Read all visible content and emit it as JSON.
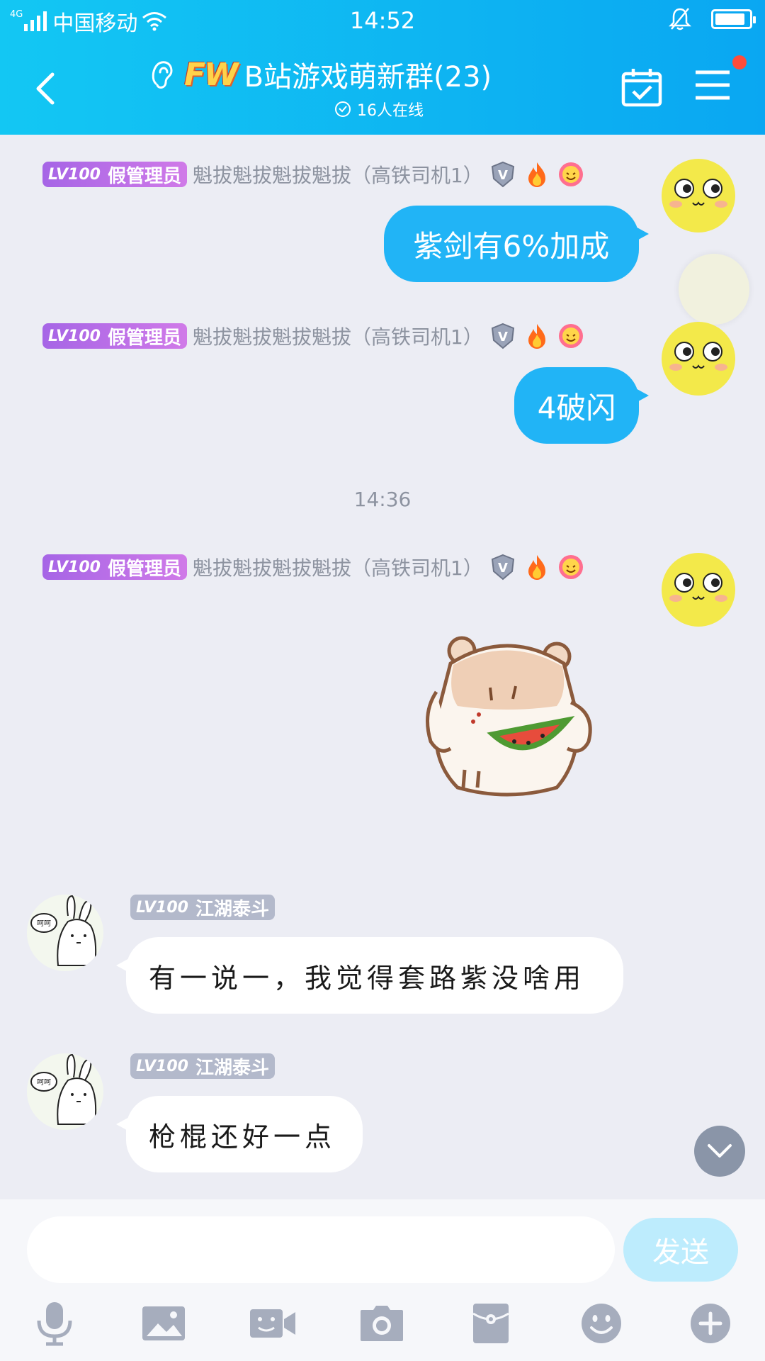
{
  "status_bar": {
    "network_tag": "4G",
    "carrier": "中国移动",
    "time": "14:52",
    "battery_level": 0.9
  },
  "header": {
    "logo_text": "FW",
    "group_name": "B站游戏萌新群(23)",
    "online_text": "16人在线",
    "notification_dot_color": "#ff4c3b"
  },
  "messages": [
    {
      "side": "right",
      "badge_level": "LV100",
      "badge_title": "假管理员",
      "sender": "魁拔魁拔魁拔魁拔（高铁司机1）",
      "text": "紫剑有6%加成"
    },
    {
      "side": "right",
      "badge_level": "LV100",
      "badge_title": "假管理员",
      "sender": "魁拔魁拔魁拔魁拔（高铁司机1）",
      "text": "4破闪"
    },
    {
      "side": "right",
      "badge_level": "LV100",
      "badge_title": "假管理员",
      "sender": "魁拔魁拔魁拔魁拔（高铁司机1）",
      "sticker": "hamster-eating-watermelon"
    },
    {
      "side": "left",
      "badge_level": "LV100",
      "badge_title": "江湖泰斗",
      "text": "有一说一，我觉得套路紫没啥用"
    },
    {
      "side": "left",
      "badge_level": "LV100",
      "badge_title": "江湖泰斗",
      "text": "枪棍还好一点"
    }
  ],
  "time_divider": "14:36",
  "input": {
    "placeholder": "",
    "send_label": "发送"
  },
  "toolbar_icons": [
    "microphone-icon",
    "image-icon",
    "video-call-icon",
    "camera-icon",
    "red-packet-icon",
    "emoji-icon",
    "plus-icon"
  ],
  "colors": {
    "header": "#13c7f3",
    "bubble_self": "#21b4f6",
    "bubble_other": "#ffffff",
    "chat_bg": "#ecedf4",
    "send_disabled": "#bdecfd"
  }
}
